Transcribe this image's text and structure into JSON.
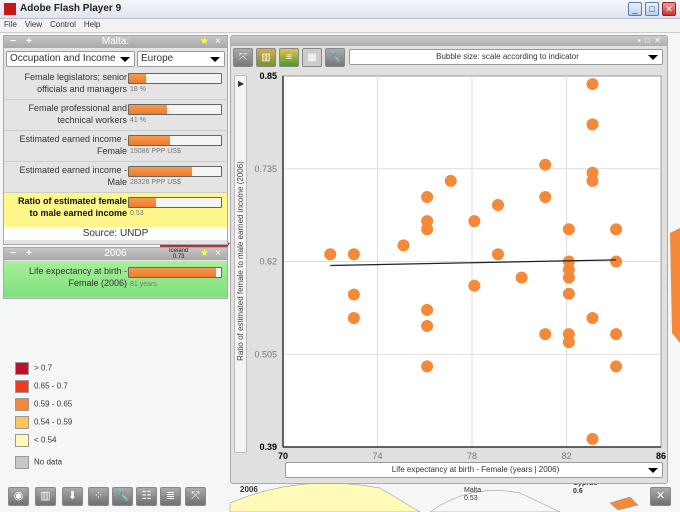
{
  "window": {
    "title": "Adobe Flash Player 9",
    "controls": [
      "_",
      "□",
      "✕"
    ]
  },
  "menu": [
    "File",
    "View",
    "Control",
    "Help"
  ],
  "country_panel": {
    "title": "Malta:",
    "minus": "−",
    "plus": "+",
    "category": "Occupation and Income",
    "region": "Europe",
    "indicators": [
      {
        "label": "Female legislators; senior officials and managers",
        "value": "18 %",
        "fill": 0.18
      },
      {
        "label": "Female professional and technical workers",
        "value": "41 %",
        "fill": 0.41
      },
      {
        "label": "Estimated earned income - Female",
        "value": "15086  PPP US$",
        "fill": 0.45
      },
      {
        "label": "Estimated earned income - Male",
        "value": "28328  PPP US$",
        "fill": 0.68
      },
      {
        "label": "Ratio of estimated female to male earned income",
        "value": "0.53",
        "fill": 0.29,
        "highlight": true
      }
    ],
    "source": "Source: UNDP"
  },
  "year_panel": {
    "title": "2006",
    "map_label": "Iceland",
    "map_value": "0.73",
    "indicator": {
      "label": "Life expectancy at birth - Female (2006)",
      "value": "81 years",
      "fill": 0.95
    }
  },
  "legend": [
    {
      "label": "> 0.7",
      "color": "#c0102a"
    },
    {
      "label": "0.65 - 0.7",
      "color": "#ee3a1e"
    },
    {
      "label": "0.59 - 0.65",
      "color": "#f5893a"
    },
    {
      "label": "0.54 - 0.59",
      "color": "#fdc55a"
    },
    {
      "label": "< 0.54",
      "color": "#fffab8"
    },
    {
      "label": "No data",
      "color": "#c8c8c8"
    }
  ],
  "map_labels": {
    "year": "2006",
    "malta": "Malta",
    "malta_value": "0.53",
    "cyprus": "Cyprus",
    "cyprus_value": "0.6"
  },
  "chart_window": {
    "bubble_select": "Bubble size: scale according to indicator",
    "x_select": "Life expectancy at birth - Female  (years | 2006)"
  },
  "chart_data": {
    "type": "scatter",
    "xlabel": "Life expectancy at birth - Female  (years | 2006)",
    "ylabel": "Ratio of estimated female to male earned income (2006)",
    "xlim": [
      70,
      86
    ],
    "ylim": [
      0.39,
      0.85
    ],
    "xticks": [
      "70",
      "74",
      "78",
      "82",
      "86"
    ],
    "yticks": [
      "0.39",
      "0.505",
      "0.62",
      "0.735",
      "0.85"
    ],
    "color": "#f5893a",
    "points": [
      [
        72,
        0.629
      ],
      [
        73,
        0.629
      ],
      [
        73,
        0.579
      ],
      [
        73,
        0.55
      ],
      [
        75.1,
        0.64
      ],
      [
        76.1,
        0.7
      ],
      [
        76.1,
        0.67
      ],
      [
        76.1,
        0.66
      ],
      [
        76.1,
        0.56
      ],
      [
        76.1,
        0.54
      ],
      [
        76.1,
        0.49
      ],
      [
        77.1,
        0.72
      ],
      [
        78.1,
        0.67
      ],
      [
        78.1,
        0.59
      ],
      [
        79.1,
        0.69
      ],
      [
        79.1,
        0.629
      ],
      [
        80.1,
        0.6
      ],
      [
        81.1,
        0.74
      ],
      [
        81.1,
        0.7
      ],
      [
        81.1,
        0.53
      ],
      [
        82.1,
        0.66
      ],
      [
        82.1,
        0.62
      ],
      [
        82.1,
        0.61
      ],
      [
        82.1,
        0.6
      ],
      [
        82.1,
        0.58
      ],
      [
        82.1,
        0.53
      ],
      [
        82.1,
        0.52
      ],
      [
        83.1,
        0.84
      ],
      [
        83.1,
        0.79
      ],
      [
        83.1,
        0.73
      ],
      [
        83.1,
        0.72
      ],
      [
        83.1,
        0.55
      ],
      [
        83.1,
        0.4
      ],
      [
        84.1,
        0.66
      ],
      [
        84.1,
        0.62
      ],
      [
        84.1,
        0.53
      ],
      [
        84.1,
        0.49
      ]
    ],
    "trendline": [
      [
        72,
        0.615
      ],
      [
        84.1,
        0.622
      ]
    ]
  }
}
